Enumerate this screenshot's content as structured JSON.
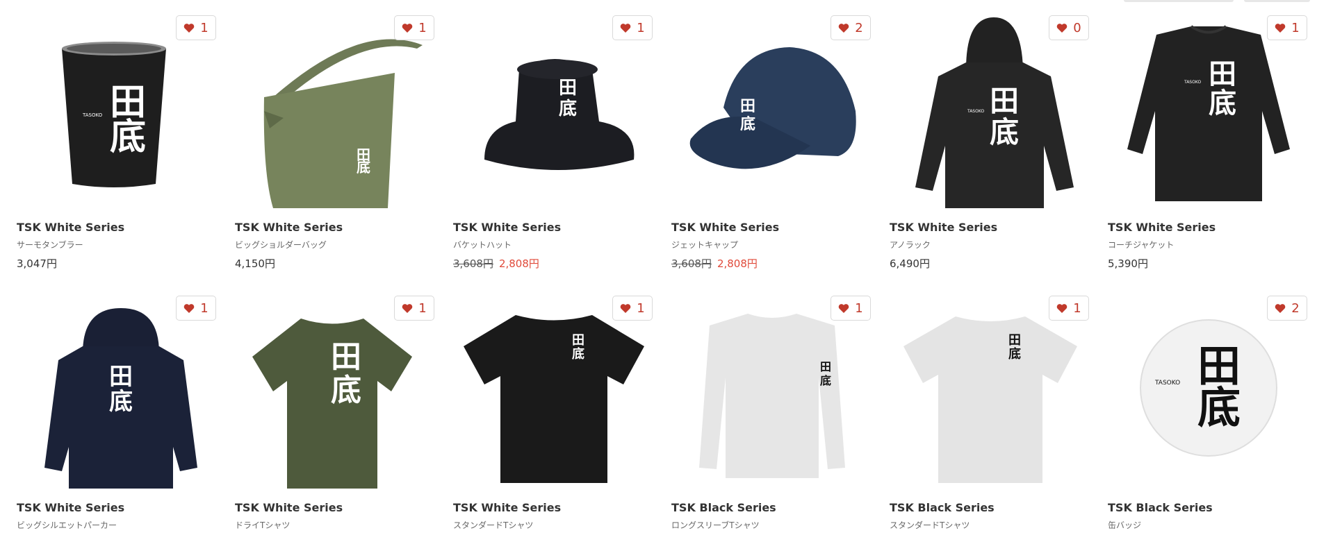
{
  "products": [
    {
      "title": "TSK White Series",
      "subtitle": "サーモタンブラー",
      "price": "3,047円",
      "likes": "1",
      "icon": "thermo-tumbler"
    },
    {
      "title": "TSK White Series",
      "subtitle": "ビッグショルダーバッグ",
      "price": "4,150円",
      "likes": "1",
      "icon": "shoulder-bag"
    },
    {
      "title": "TSK White Series",
      "subtitle": "バケットハット",
      "price": "3,608円",
      "sale_price": "2,808円",
      "likes": "1",
      "icon": "bucket-hat"
    },
    {
      "title": "TSK White Series",
      "subtitle": "ジェットキャップ",
      "price": "3,608円",
      "sale_price": "2,808円",
      "likes": "2",
      "icon": "jet-cap"
    },
    {
      "title": "TSK White Series",
      "subtitle": "アノラック",
      "price": "6,490円",
      "likes": "0",
      "icon": "anorak"
    },
    {
      "title": "TSK White Series",
      "subtitle": "コーチジャケット",
      "price": "5,390円",
      "likes": "1",
      "icon": "coach-jacket"
    },
    {
      "title": "TSK White Series",
      "subtitle": "ビッグシルエットパーカー",
      "likes": "1",
      "icon": "hoodie"
    },
    {
      "title": "TSK White Series",
      "subtitle": "ドライTシャツ",
      "likes": "1",
      "icon": "dry-tshirt"
    },
    {
      "title": "TSK White Series",
      "subtitle": "スタンダードTシャツ",
      "likes": "1",
      "icon": "standard-tshirt"
    },
    {
      "title": "TSK Black Series",
      "subtitle": "ロングスリーブTシャツ",
      "likes": "1",
      "icon": "long-sleeve-tshirt"
    },
    {
      "title": "TSK Black Series",
      "subtitle": "スタンダードTシャツ",
      "likes": "1",
      "icon": "standard-tshirt-white"
    },
    {
      "title": "TSK Black Series",
      "subtitle": "缶バッジ",
      "likes": "2",
      "icon": "can-badge"
    }
  ],
  "colors": {
    "heart": "#c0392b",
    "sale": "#e04a3a"
  }
}
